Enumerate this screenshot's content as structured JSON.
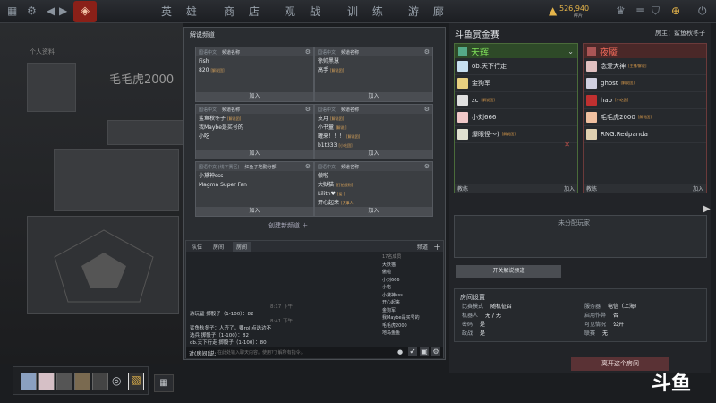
{
  "nav": {
    "items": [
      "英 雄",
      "商 店",
      "观 战",
      "训 练",
      "游 廊"
    ],
    "gold": "526,940",
    "gold_sub": "碎片"
  },
  "left": {
    "profile_name": "毛毛虎2000",
    "label": "个人资料"
  },
  "chat": {
    "title": "解说频道",
    "channels": [
      {
        "lang": "国语中文",
        "name_header": "频道名称",
        "rows": [
          {
            "t": "Fish",
            "tag": ""
          },
          {
            "t": "820",
            "tag": "[解说团]"
          }
        ],
        "join": "加入"
      },
      {
        "lang": "国语中文",
        "name_header": "频道名称",
        "rows": [
          {
            "t": "徐帅黑慧",
            "tag": ""
          },
          {
            "t": "高手",
            "tag": "[解说团]"
          }
        ],
        "join": "加入"
      },
      {
        "lang": "国语中文",
        "name_header": "频道名称",
        "rows": [
          {
            "t": "鲨鱼秋冬子",
            "tag": "[解说团]"
          },
          {
            "t": "我Maybe是买号的",
            "tag": ""
          },
          {
            "t": "小吃",
            "tag": ""
          }
        ],
        "join": "加入"
      },
      {
        "lang": "国语中文",
        "name_header": "频道名称",
        "rows": [
          {
            "t": "支月",
            "tag": "[解说团]"
          },
          {
            "t": "小书童",
            "tag": "[解说 ]"
          },
          {
            "t": "罐来！！！",
            "tag": "[解说团]"
          },
          {
            "t": "b1t333",
            "tag": "[小吃团]"
          }
        ],
        "join": "加入"
      },
      {
        "lang": "国语中文 (线下赛区)",
        "name_header": "红鱼子地勤分部",
        "rows": [
          {
            "t": "小黛神sss",
            "tag": ""
          },
          {
            "t": "Magma Super Fan",
            "tag": ""
          }
        ],
        "join": "加入"
      },
      {
        "lang": "国语中文",
        "name_header": "频道名称",
        "rows": [
          {
            "t": "傲啦",
            "tag": ""
          },
          {
            "t": "大狱猫",
            "tag": "[打拍规则]"
          },
          {
            "t": "Lilith♥",
            "tag": "[爱 ]"
          },
          {
            "t": "开心起来",
            "tag": "[大事人]"
          }
        ],
        "join": "加入"
      }
    ],
    "create": "创建新频道",
    "tabs": [
      "队伍",
      "房间",
      "房间"
    ],
    "tab_right": "频道",
    "messages": [
      "8:17 下午",
      "  游玩鲨 掷骰子（1-100）：82",
      "8:41 下午",
      "  鲨鱼秋冬子：人齐了，要roll点选边不",
      "  选兵 掷骰子（1-100）：82",
      "ob.天下行走 掷骰子（1-100）：80"
    ],
    "members": [
      "17名成员",
      "大妖猫",
      "傲啦",
      "小刘666",
      "小吃",
      "小黛神sss",
      "开心起来",
      "金狗军",
      "我Maybe是买号的",
      "毛毛虎2000",
      "地岛鱼鱼"
    ],
    "input_label": "对(房间)说:",
    "input_placeholder": "在此处输入聊天内容。使用?了解所有指令。"
  },
  "right": {
    "title": "斗鱼赏金赛",
    "host": "房主：鲨鱼秋冬子",
    "radiant": {
      "name": "天辉",
      "players": [
        {
          "n": "ob.天下行走",
          "tag": ""
        },
        {
          "n": "金狗军",
          "tag": ""
        },
        {
          "n": "zc",
          "tag": "[解说团]"
        },
        {
          "n": "小刘666",
          "tag": ""
        },
        {
          "n": "爆眼怪～)",
          "tag": "[解说团]"
        }
      ],
      "coach": "教练",
      "join": "加入"
    },
    "dire": {
      "name": "夜魇",
      "players": [
        {
          "n": "念爱大神",
          "tag": "[主播/解说]"
        },
        {
          "n": "ghost",
          "tag": "[解说团]"
        },
        {
          "n": "hao",
          "tag": "[小吃团]"
        },
        {
          "n": "毛毛虎2000",
          "tag": "[解说团]"
        },
        {
          "n": "RNG.Redpanda",
          "tag": ""
        }
      ],
      "coach": "教练",
      "join": "加入"
    },
    "unassigned": "未分配玩家",
    "toggle_btn": "开关解说频道",
    "settings_title": "房间设置",
    "settings": [
      {
        "k": "比赛模式",
        "v": "随机征召"
      },
      {
        "k": "服务器",
        "v": "电信（上海）"
      },
      {
        "k": "机器人",
        "v": "无 / 无"
      },
      {
        "k": "启用作弊",
        "v": "否"
      },
      {
        "k": "密码",
        "v": "是"
      },
      {
        "k": "可见情况",
        "v": "公开"
      },
      {
        "k": "政战",
        "v": "是"
      },
      {
        "k": "联赛",
        "v": "无"
      }
    ],
    "leave_btn": "离开这个房间"
  },
  "watermark": "斗鱼",
  "colors": {
    "radiant": "#6ad04a",
    "dire": "#e05040",
    "accent": "#e6b54a"
  }
}
